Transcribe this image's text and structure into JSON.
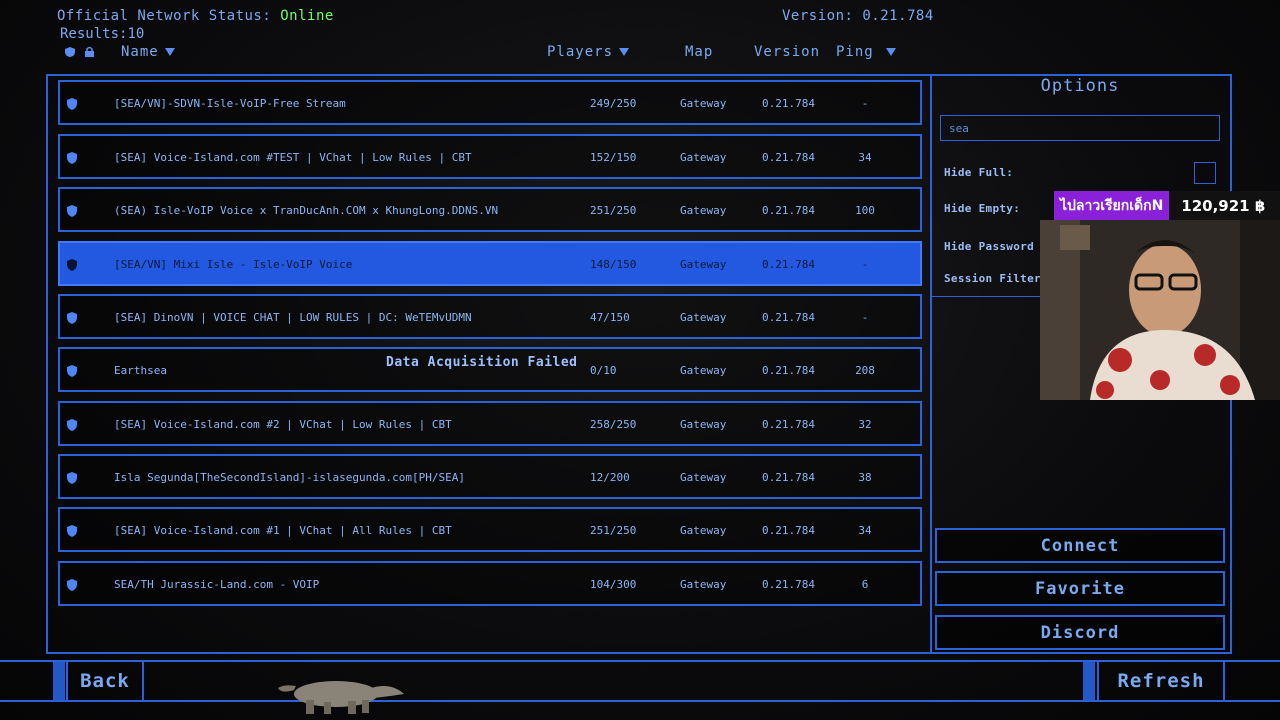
{
  "top": {
    "status_prefix": "Official Network Status:",
    "status_value": "Online",
    "results_label": "Results:",
    "results_count": "10",
    "version": "Version: 0.21.784"
  },
  "headers": {
    "name": "Name",
    "players": "Players",
    "map": "Map",
    "version": "Version",
    "ping": "Ping"
  },
  "servers": [
    {
      "name": "[SEA/VN]-SDVN-Isle-VoIP-Free Stream",
      "players": "249/250",
      "map": "Gateway",
      "version": "0.21.784",
      "ping": "-"
    },
    {
      "name": "[SEA] Voice-Island.com #TEST | VChat | Low Rules | CBT",
      "players": "152/150",
      "map": "Gateway",
      "version": "0.21.784",
      "ping": "34"
    },
    {
      "name": "(SEA) Isle-VoIP Voice x TranDucAnh.COM x KhungLong.DDNS.VN",
      "players": "251/250",
      "map": "Gateway",
      "version": "0.21.784",
      "ping": "100"
    },
    {
      "name": "[SEA/VN] Mixi Isle - Isle-VoIP Voice",
      "players": "148/150",
      "map": "Gateway",
      "version": "0.21.784",
      "ping": "-"
    },
    {
      "name": "[SEA] DinoVN | VOICE CHAT | LOW RULES | DC: WeTEMvUDMN",
      "players": "47/150",
      "map": "Gateway",
      "version": "0.21.784",
      "ping": "-"
    },
    {
      "name": "Earthsea",
      "players": "0/10",
      "map": "Gateway",
      "version": "0.21.784",
      "ping": "208"
    },
    {
      "name": "[SEA] Voice-Island.com #2 | VChat | Low Rules | CBT",
      "players": "258/250",
      "map": "Gateway",
      "version": "0.21.784",
      "ping": "32"
    },
    {
      "name": "Isla Segunda[TheSecondIsland]-islasegunda.com[PH/SEA]",
      "players": "12/200",
      "map": "Gateway",
      "version": "0.21.784",
      "ping": "38"
    },
    {
      "name": "[SEA] Voice-Island.com #1 | VChat | All Rules | CBT",
      "players": "251/250",
      "map": "Gateway",
      "version": "0.21.784",
      "ping": "34"
    },
    {
      "name": "SEA/TH Jurassic-Land.com - VOIP",
      "players": "104/300",
      "map": "Gateway",
      "version": "0.21.784",
      "ping": "6"
    }
  ],
  "selected_row": 3,
  "fail_message": "Data Acquisition Failed",
  "options": {
    "title": "Options",
    "search_value": "sea",
    "hide_full": "Hide Full:",
    "hide_empty": "Hide Empty:",
    "hide_password": "Hide Password P",
    "session_filter": "Session Filter:"
  },
  "buttons": {
    "connect": "Connect",
    "favorite": "Favorite",
    "discord": "Discord",
    "back": "Back",
    "refresh": "Refresh"
  },
  "overlay": {
    "donation_name": "ไปลาวเรียกเด็กN",
    "donation_amount": "120,921 ฿"
  },
  "colors": {
    "accent": "#2b62d9",
    "selected_row": "#2358e0",
    "online": "#6cff6c"
  }
}
